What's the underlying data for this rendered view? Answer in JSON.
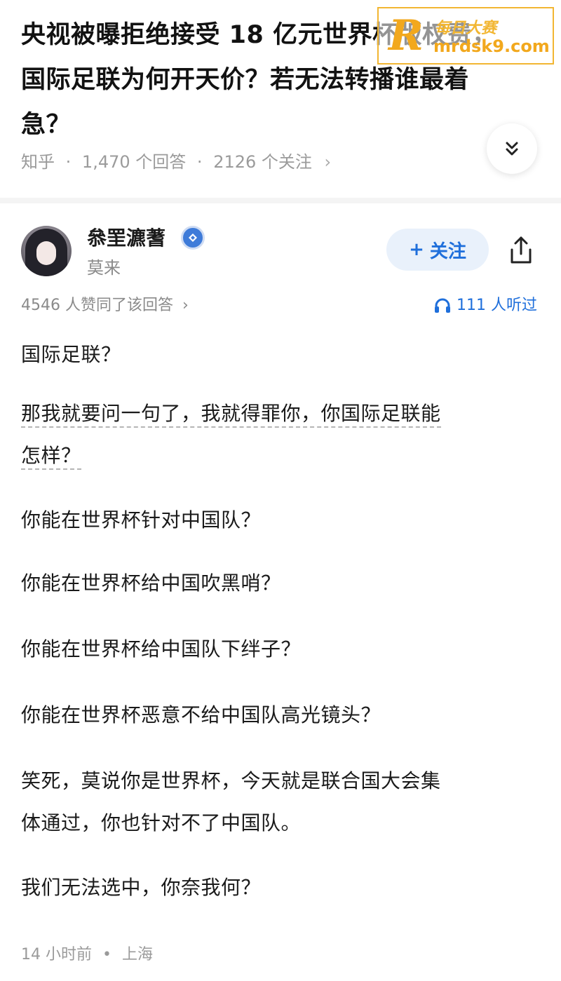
{
  "question": {
    "title": "央视被曝拒绝接受 18 亿元世界杯版权费，国际足联为何开天价？若无法转播谁最着急？",
    "title_lines": [
      "央视被曝拒绝接受 18 亿元世界杯版权费，",
      "国际足联为何开天价？若无法转播谁最着",
      "急？"
    ],
    "source": "知乎",
    "answers_count": "1,470 个回答",
    "followers_count": "2126 个关注",
    "separator": "·",
    "chevron": "›"
  },
  "watermark": {
    "letter": "R",
    "cn_text": "每日大赛",
    "url": "mrdsk9.com"
  },
  "answer": {
    "author_name": "叅罜瀌蓍",
    "author_subtitle": "莫来",
    "follow_label": "关注",
    "follow_plus": "+",
    "likes_text": "4546 人赞同了该回答",
    "likes_chevron": "›",
    "listens_text": "111 人听过",
    "paragraphs": [
      "国际足联？",
      "那我就要问一句了，我就得罪你，你国际足联能",
      "怎样？",
      "你能在世界杯针对中国队？",
      "你能在世界杯给中国吹黑哨？",
      "你能在世界杯给中国队下绊子？",
      "你能在世界杯恶意不给中国队高光镜头？",
      "笑死，莫说你是世界杯，今天就是联合国大会集",
      "体通过，你也针对不了中国队。",
      "我们无法选中，你奈我何？"
    ],
    "time": "14 小时前",
    "location": "上海",
    "footer_dot": "•"
  },
  "icons": {
    "expand": "double-chevron-down-icon",
    "verified": "verified-badge-icon",
    "share": "share-icon",
    "headphones": "headphones-icon"
  },
  "colors": {
    "accent_blue": "#1f6fdb",
    "watermark_orange": "#f2a81d",
    "meta_gray": "#9b9b9b"
  }
}
